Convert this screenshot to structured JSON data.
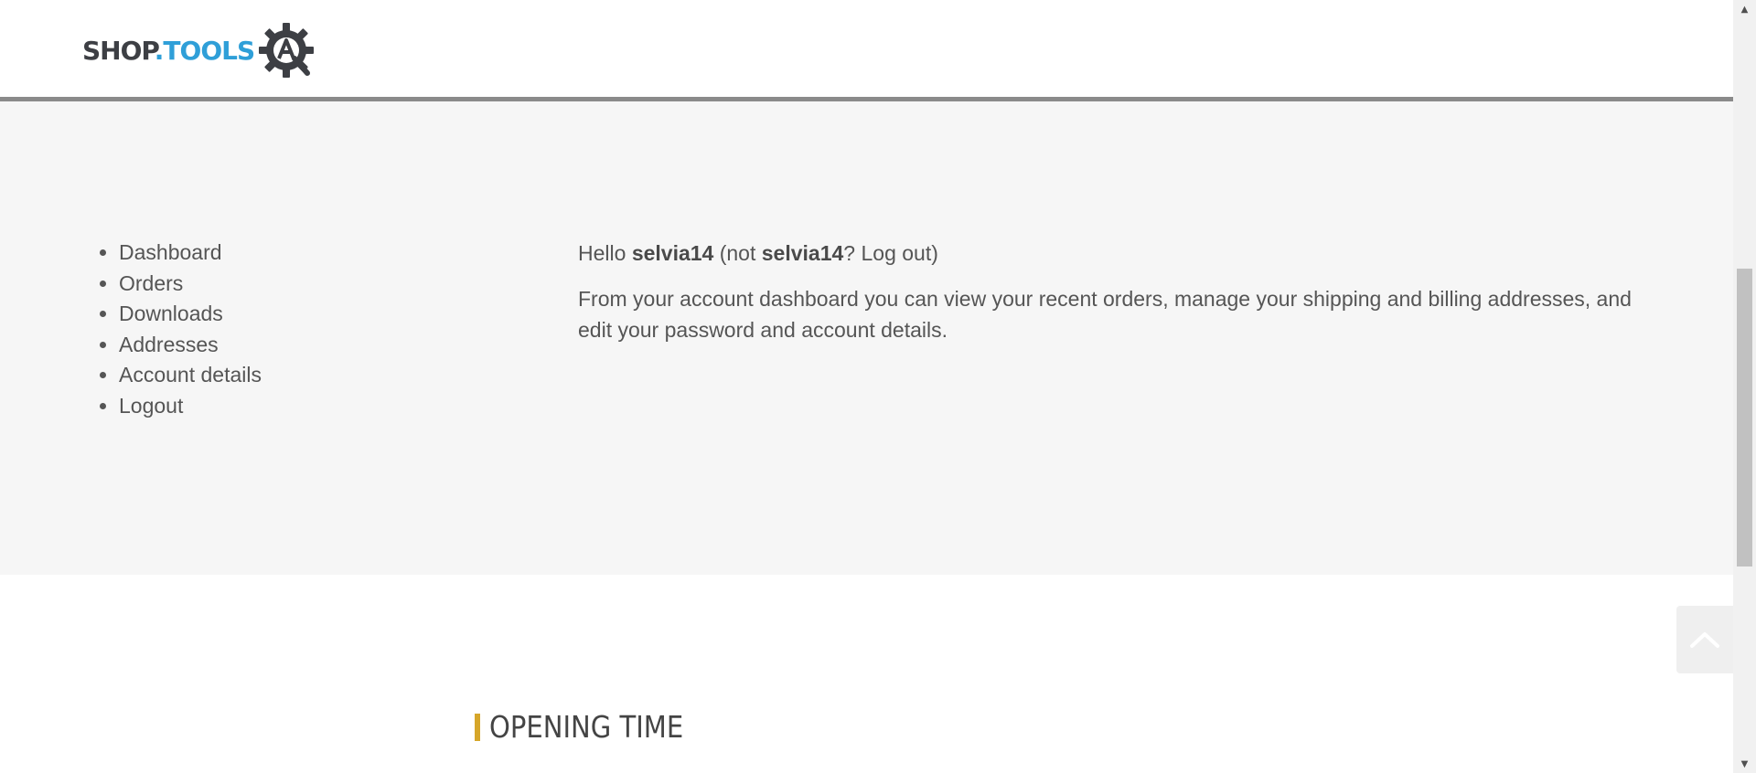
{
  "header": {
    "logo": {
      "shop_text": "SHOP",
      "dot_tools_text": ".TOOLS",
      "icon": "gear-wrench-logo-icon",
      "colors": {
        "shop": "#3d3f44",
        "tools": "#2f9fd8"
      }
    }
  },
  "account": {
    "nav": [
      {
        "label": "Dashboard"
      },
      {
        "label": "Orders"
      },
      {
        "label": "Downloads"
      },
      {
        "label": "Addresses"
      },
      {
        "label": "Account details"
      },
      {
        "label": "Logout"
      }
    ],
    "greeting": {
      "hello": "Hello ",
      "username": "selvia14",
      "not_prefix": " (not ",
      "username_again": "selvia14",
      "question": "? ",
      "logout_label": "Log out",
      "close_paren": ")"
    },
    "intro": "From your account dashboard you can view your recent orders, manage your shipping and billing addresses, and edit your password and account details."
  },
  "footer": {
    "opening_title": "OPENING TIME",
    "accent_color": "#d6a62a"
  },
  "back_to_top": {
    "icon": "chevron-up-icon"
  },
  "scrollbar": {
    "up_icon": "scroll-up-arrow-icon",
    "down_icon": "scroll-down-arrow-icon"
  }
}
